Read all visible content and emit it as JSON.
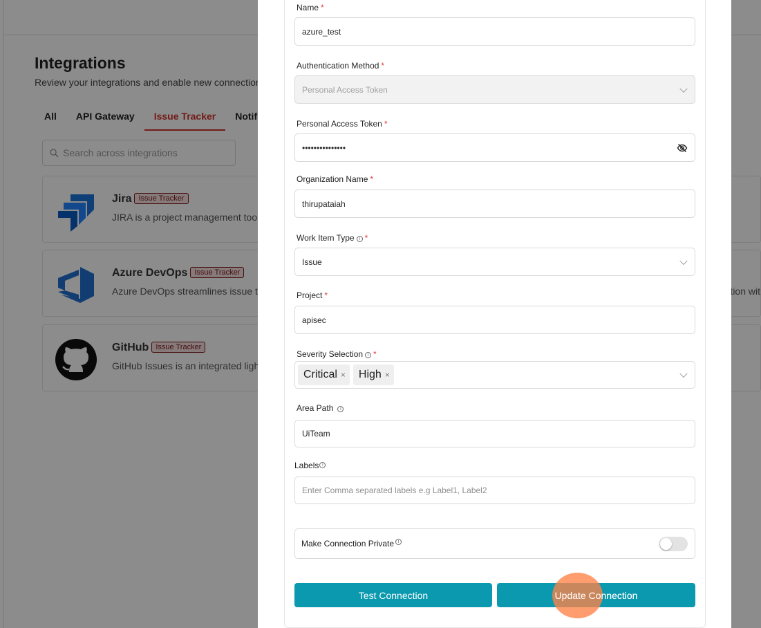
{
  "background": {
    "title": "Integrations",
    "subtitle": "Review your integrations and enable new connections",
    "tabs": [
      {
        "label": "All",
        "active": false
      },
      {
        "label": "API Gateway",
        "active": false
      },
      {
        "label": "Issue Tracker",
        "active": true
      },
      {
        "label": "Notif",
        "active": false
      }
    ],
    "search_placeholder": "Search across integrations",
    "cards": [
      {
        "name": "Jira",
        "badge": "Issue Tracker",
        "description": "JIRA is a project management too",
        "description_right": ""
      },
      {
        "name": "Azure DevOps",
        "badge": "Issue Tracker",
        "description": "Azure DevOps streamlines issue t",
        "description_right": "ation wit"
      },
      {
        "name": "GitHub",
        "badge": "Issue Tracker",
        "description": "GitHub Issues is an integrated ligh",
        "description_right": ""
      }
    ]
  },
  "form": {
    "name": {
      "label": "Name",
      "value": "azure_test"
    },
    "auth_method": {
      "label": "Authentication Method",
      "value": "Personal Access Token"
    },
    "pat": {
      "label": "Personal Access Token",
      "value": "•••••••••••••••"
    },
    "org": {
      "label": "Organization Name",
      "value": "thirupataiah"
    },
    "work_item_type": {
      "label": "Work Item Type",
      "value": "Issue"
    },
    "project": {
      "label": "Project",
      "value": "apisec"
    },
    "severity": {
      "label": "Severity Selection",
      "tags": [
        "Critical",
        "High"
      ]
    },
    "area_path": {
      "label": "Area Path",
      "value": "UiTeam"
    },
    "labels": {
      "label": "Labels",
      "placeholder": "Enter Comma separated labels e.g Label1, Label2"
    },
    "private": {
      "label": "Make Connection Private",
      "enabled": false
    },
    "required_mark": "*",
    "info_glyph": "i",
    "remove_glyph": "×"
  },
  "buttons": {
    "test": "Test Connection",
    "update": "Update Connection"
  },
  "colors": {
    "accent": "#0a99ae",
    "tab_active": "#d0332a",
    "required": "#e03a3a",
    "click_indicator": "#ff8246"
  }
}
